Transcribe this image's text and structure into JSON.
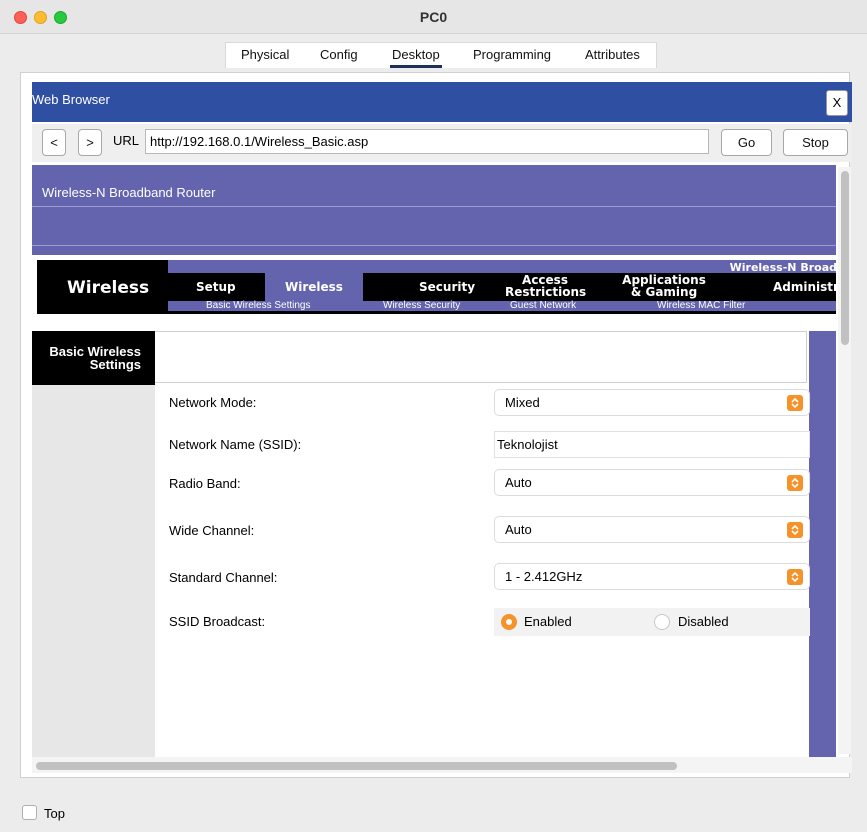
{
  "window": {
    "title": "PC0"
  },
  "tabs": [
    {
      "label": "Physical"
    },
    {
      "label": "Config"
    },
    {
      "label": "Desktop",
      "active": true
    },
    {
      "label": "Programming"
    },
    {
      "label": "Attributes"
    }
  ],
  "browser": {
    "title": "Web Browser",
    "close_label": "X",
    "back_label": "<",
    "forward_label": ">",
    "url_label": "URL",
    "url_value": "http://192.168.0.1/Wireless_Basic.asp",
    "go_label": "Go",
    "stop_label": "Stop"
  },
  "router": {
    "title": "Wireless-N Broadband Router",
    "brand_banner": "Wireless-N Broad",
    "section_title": "Wireless",
    "nav": [
      {
        "label": "Setup"
      },
      {
        "label": "Wireless",
        "active": true
      },
      {
        "label": "Security"
      },
      {
        "label": "Access\nRestrictions"
      },
      {
        "label": "Applications\n& Gaming"
      },
      {
        "label": "Administra"
      }
    ],
    "subnav": [
      {
        "label": "Basic Wireless Settings"
      },
      {
        "label": "Wireless Security"
      },
      {
        "label": "Guest Network"
      },
      {
        "label": "Wireless MAC Filter"
      }
    ],
    "sidebar_title": "Basic Wireless\nSettings",
    "fields": {
      "network_mode": {
        "label": "Network Mode:",
        "value": "Mixed"
      },
      "ssid": {
        "label": "Network Name (SSID):",
        "value": "Teknolojist"
      },
      "radio_band": {
        "label": "Radio Band:",
        "value": "Auto"
      },
      "wide_channel": {
        "label": "Wide Channel:",
        "value": "Auto"
      },
      "standard_channel": {
        "label": "Standard Channel:",
        "value": "1 - 2.412GHz"
      },
      "ssid_broadcast": {
        "label": "SSID Broadcast:",
        "options": [
          {
            "label": "Enabled",
            "selected": true
          },
          {
            "label": "Disabled",
            "selected": false
          }
        ]
      }
    },
    "colors": {
      "accent": "#6363ae",
      "select_arrow": "#f5922a",
      "browser_header": "#2f4fa2"
    }
  },
  "footer": {
    "top_checkbox_label": "Top",
    "top_checked": false
  }
}
